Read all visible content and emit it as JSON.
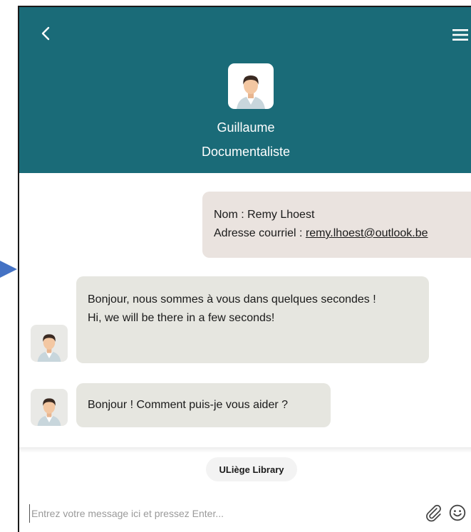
{
  "header": {
    "agent_name": "Guillaume",
    "agent_role": "Documentaliste",
    "background_color": "#1a6b78",
    "back_icon": "chevron-left-icon",
    "menu_icon": "hamburger-menu-icon"
  },
  "messages": {
    "user_info": {
      "name_line": "Nom : Remy Lhoest",
      "email_label": "Adresse courriel : ",
      "email_value": "remy.lhoest@outlook.be"
    },
    "bot_welcome": {
      "line_fr": "Bonjour, nous sommes à vous dans quelques secondes !",
      "line_en": "Hi, we will be there in a few seconds!"
    },
    "bot_greeting": {
      "text": "Bonjour ! Comment puis-je vous aider ?"
    }
  },
  "footer": {
    "chip_label": "ULiège Library",
    "input_placeholder": "Entrez votre message ici et pressez Enter...",
    "attach_icon": "paperclip-icon",
    "emoji_icon": "smiley-icon"
  }
}
